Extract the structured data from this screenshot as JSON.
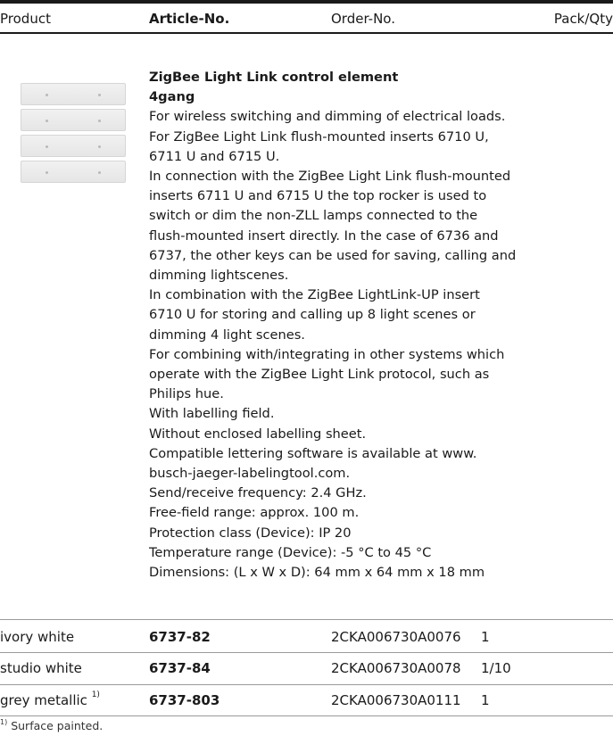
{
  "table_header": {
    "product": "Product",
    "article": "Article-No.",
    "order": "Order-No.",
    "pack": "Pack/Qty"
  },
  "product": {
    "title_line1": "ZigBee Light Link control element",
    "title_line2": "4gang",
    "description_lines": [
      "For wireless switching and dimming of electrical loads.",
      "For ZigBee Light Link flush-mounted inserts 6710 U,",
      "6711 U and 6715 U.",
      "In connection with the ZigBee Light Link flush-mounted",
      "inserts 6711 U and 6715 U the top rocker is used to",
      "switch or dim the non-ZLL lamps connected to the",
      "flush-mounted insert directly. In the case of 6736 and",
      "6737, the other keys can be used for saving, calling and",
      "dimming lightscenes.",
      "In combination with the ZigBee LightLink-UP insert",
      "6710 U for storing and calling up 8 light scenes or",
      "dimming 4 light scenes.",
      "For combining with/integrating in other systems which",
      "operate with the ZigBee Light Link protocol, such as",
      "Philips hue.",
      "With labelling field.",
      "Without enclosed labelling sheet.",
      "Compatible lettering software is available at www.",
      "busch-jaeger-labelingtool.com.",
      "Send/receive frequency: 2.4 GHz.",
      "Free-field range: approx. 100 m.",
      "Protection class (Device): IP 20",
      "Temperature range (Device): -5 °C to 45 °C",
      "Dimensions: (L x W x D): 64 mm x 64 mm x 18 mm"
    ]
  },
  "variants": [
    {
      "product": "ivory white",
      "footnote_mark": "",
      "article": "6737-82",
      "order": "2CKA006730A0076",
      "pack": "1"
    },
    {
      "product": "studio white",
      "footnote_mark": "",
      "article": "6737-84",
      "order": "2CKA006730A0078",
      "pack": "1/10"
    },
    {
      "product": "grey metallic",
      "footnote_mark": "1)",
      "article": "6737-803",
      "order": "2CKA006730A0111",
      "pack": "1"
    }
  ],
  "footnote": {
    "mark": "1)",
    "text": "Surface painted."
  }
}
